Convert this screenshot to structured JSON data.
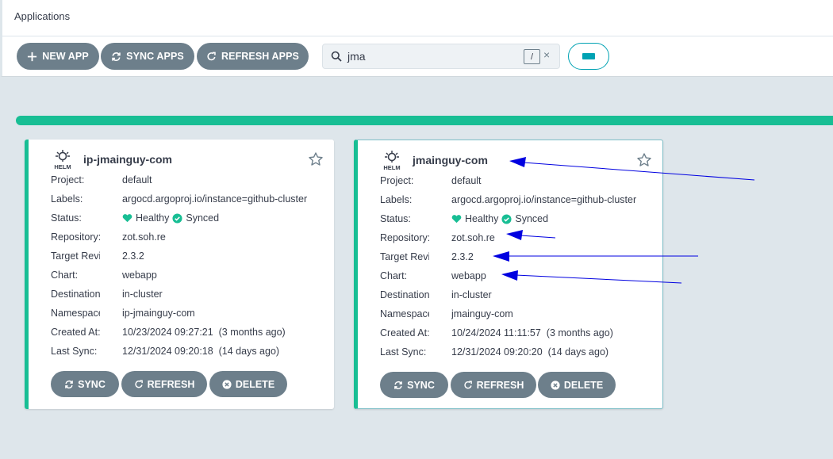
{
  "header": {
    "title": "Applications"
  },
  "toolbar": {
    "new_app": "NEW APP",
    "sync_apps": "SYNC APPS",
    "refresh_apps": "REFRESH APPS"
  },
  "search": {
    "value": "jma",
    "shortcut": "/",
    "clear": "×"
  },
  "colors": {
    "accent": "#18be94",
    "button": "#6d7f8b",
    "teal": "#00a2b3",
    "annotation": "#0000e0"
  },
  "icons": [
    "plus-icon",
    "sync-icon",
    "refresh-icon",
    "search-icon",
    "close-icon",
    "view-toggle-icon",
    "helm-icon",
    "star-icon",
    "heart-icon",
    "check-circle-icon",
    "delete-icon"
  ],
  "apps": [
    {
      "name": "ip-jmainguy-com",
      "rows": {
        "project": {
          "label": "Project:",
          "value": "default"
        },
        "labels": {
          "label": "Labels:",
          "value": "argocd.argoproj.io/instance=github-cluster"
        },
        "status": {
          "label": "Status:",
          "health": "Healthy",
          "sync": "Synced"
        },
        "repo": {
          "label": "Repository:",
          "value": "zot.soh.re"
        },
        "target": {
          "label": "Target Revision:",
          "value": "2.3.2"
        },
        "chart": {
          "label": "Chart:",
          "value": "webapp"
        },
        "dest": {
          "label": "Destination:",
          "value": "in-cluster"
        },
        "ns": {
          "label": "Namespace:",
          "value": "ip-jmainguy-com"
        },
        "created": {
          "label": "Created At:",
          "value": "10/23/2024 09:27:21  (3 months ago)"
        },
        "lastsync": {
          "label": "Last Sync:",
          "value": "12/31/2024 09:20:18  (14 days ago)"
        }
      },
      "buttons": {
        "sync": "SYNC",
        "refresh": "REFRESH",
        "delete": "DELETE"
      }
    },
    {
      "name": "jmainguy-com",
      "rows": {
        "project": {
          "label": "Project:",
          "value": "default"
        },
        "labels": {
          "label": "Labels:",
          "value": "argocd.argoproj.io/instance=github-cluster"
        },
        "status": {
          "label": "Status:",
          "health": "Healthy",
          "sync": "Synced"
        },
        "repo": {
          "label": "Repository:",
          "value": "zot.soh.re"
        },
        "target": {
          "label": "Target Revision:",
          "value": "2.3.2"
        },
        "chart": {
          "label": "Chart:",
          "value": "webapp"
        },
        "dest": {
          "label": "Destination:",
          "value": "in-cluster"
        },
        "ns": {
          "label": "Namespace:",
          "value": "jmainguy-com"
        },
        "created": {
          "label": "Created At:",
          "value": "10/24/2024 11:11:57  (3 months ago)"
        },
        "lastsync": {
          "label": "Last Sync:",
          "value": "12/31/2024 09:20:20  (14 days ago)"
        }
      },
      "buttons": {
        "sync": "SYNC",
        "refresh": "REFRESH",
        "delete": "DELETE"
      }
    }
  ]
}
